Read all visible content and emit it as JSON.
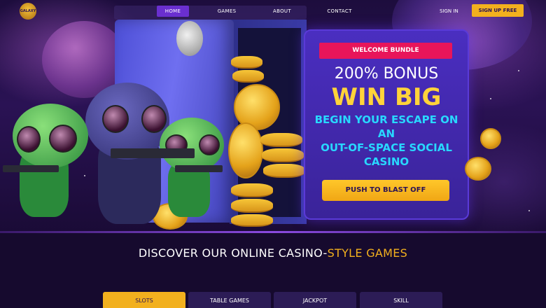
{
  "nav": {
    "logo_text": "GALAXY",
    "home": "HOME",
    "games": "GAMES",
    "about": "ABOUT",
    "contact": "CONTACT",
    "sign_in": "SIGN IN",
    "sign_up": "SIGN UP FREE"
  },
  "promo": {
    "badge": "WELCOME BUNDLE",
    "bonus": "200% BONUS",
    "headline": "WIN BIG",
    "tagline_line1": "BEGIN YOUR ESCAPE ON",
    "tagline_line2": "AN",
    "tagline_line3": "OUT-OF-SPACE SOCIAL",
    "tagline_line4": "CASINO",
    "cta": "PUSH TO BLAST OFF"
  },
  "games_section": {
    "title_main": "DISCOVER OUR ONLINE CASINO-",
    "title_accent": "STYLE GAMES",
    "tabs": [
      "SLOTS",
      "TABLE GAMES",
      "JACKPOT",
      "SKILL"
    ]
  },
  "colors": {
    "accent_gold": "#f2b01e",
    "accent_pink": "#e8155a",
    "accent_cyan": "#28d8ff",
    "nav_active": "#6a2fd0"
  }
}
